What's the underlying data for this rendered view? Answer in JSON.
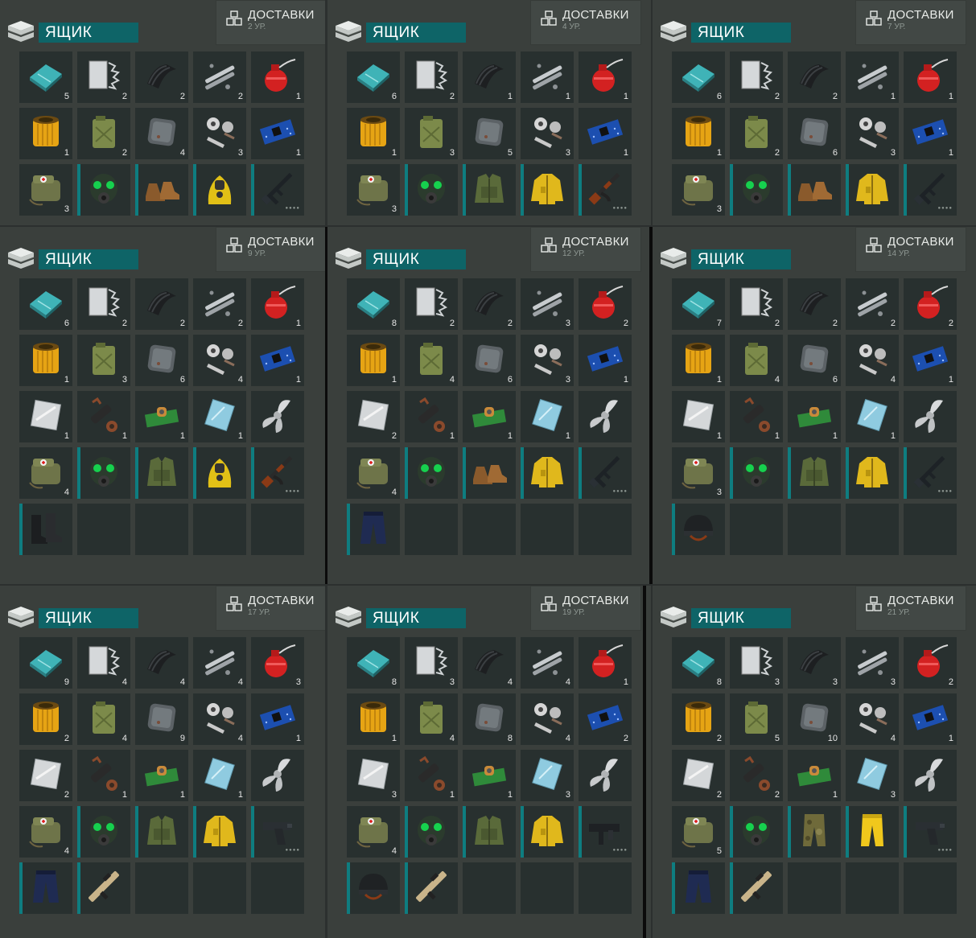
{
  "labels": {
    "box": "ЯЩИК",
    "deliveries": "ДОСТАВКИ"
  },
  "panels": [
    {
      "level": "2 УР.",
      "rows": [
        [
          [
            "glass",
            "5"
          ],
          [
            "scrap",
            "2"
          ],
          [
            "rubber",
            "2"
          ],
          [
            "pipes",
            "2"
          ],
          [
            "oil",
            "1"
          ]
        ],
        [
          [
            "filter",
            "1"
          ],
          [
            "jerrycan",
            "2"
          ],
          [
            "plate",
            "4"
          ],
          [
            "parts",
            "3"
          ],
          [
            "chip",
            "1"
          ]
        ],
        [
          [
            "medbag",
            "3"
          ],
          [
            "gasmask",
            ""
          ],
          [
            "boots",
            ""
          ],
          [
            "hazmat",
            ""
          ],
          [
            "rifle",
            ""
          ]
        ]
      ]
    },
    {
      "level": "4 УР.",
      "rows": [
        [
          [
            "glass",
            "6"
          ],
          [
            "scrap",
            "2"
          ],
          [
            "rubber",
            "1"
          ],
          [
            "pipes",
            "1"
          ],
          [
            "oil",
            "1"
          ]
        ],
        [
          [
            "filter",
            "1"
          ],
          [
            "jerrycan",
            "3"
          ],
          [
            "plate",
            "5"
          ],
          [
            "parts",
            "3"
          ],
          [
            "chip",
            "1"
          ]
        ],
        [
          [
            "medbag",
            "3"
          ],
          [
            "gasmask",
            ""
          ],
          [
            "vest",
            ""
          ],
          [
            "jacket",
            ""
          ],
          [
            "ak",
            ""
          ]
        ]
      ]
    },
    {
      "level": "7 УР.",
      "rows": [
        [
          [
            "glass",
            "6"
          ],
          [
            "scrap",
            "2"
          ],
          [
            "rubber",
            "2"
          ],
          [
            "pipes",
            "1"
          ],
          [
            "oil",
            "1"
          ]
        ],
        [
          [
            "filter",
            "1"
          ],
          [
            "jerrycan",
            "2"
          ],
          [
            "plate",
            "6"
          ],
          [
            "parts",
            "3"
          ],
          [
            "chip",
            "1"
          ]
        ],
        [
          [
            "medbag",
            "3"
          ],
          [
            "gasmask",
            ""
          ],
          [
            "boots",
            ""
          ],
          [
            "jacket",
            ""
          ],
          [
            "rifle",
            ""
          ]
        ]
      ]
    },
    {
      "level": "9 УР.",
      "rows": [
        [
          [
            "glass",
            "6"
          ],
          [
            "scrap",
            "2"
          ],
          [
            "rubber",
            "2"
          ],
          [
            "pipes",
            "2"
          ],
          [
            "oil",
            "1"
          ]
        ],
        [
          [
            "filter",
            "1"
          ],
          [
            "jerrycan",
            "3"
          ],
          [
            "plate",
            "6"
          ],
          [
            "parts",
            "4"
          ],
          [
            "chip",
            "1"
          ]
        ],
        [
          [
            "steel",
            "1"
          ],
          [
            "scope",
            "1"
          ],
          [
            "board",
            "1"
          ],
          [
            "glasspane",
            "1"
          ],
          [
            "propeller",
            ""
          ]
        ],
        [
          [
            "medbag",
            "4"
          ],
          [
            "gasmask",
            ""
          ],
          [
            "vest",
            ""
          ],
          [
            "hazmat",
            ""
          ],
          [
            "ak",
            ""
          ]
        ],
        [
          [
            "tallboots",
            ""
          ],
          [
            "",
            ""
          ],
          [
            "",
            ""
          ],
          [
            "",
            ""
          ],
          [
            "",
            ""
          ]
        ]
      ]
    },
    {
      "level": "12 УР.",
      "rows": [
        [
          [
            "glass",
            "8"
          ],
          [
            "scrap",
            "2"
          ],
          [
            "rubber",
            "2"
          ],
          [
            "pipes",
            "3"
          ],
          [
            "oil",
            "2"
          ]
        ],
        [
          [
            "filter",
            "1"
          ],
          [
            "jerrycan",
            "4"
          ],
          [
            "plate",
            "6"
          ],
          [
            "parts",
            "3"
          ],
          [
            "chip",
            "1"
          ]
        ],
        [
          [
            "steel",
            "2"
          ],
          [
            "scope",
            "1"
          ],
          [
            "board",
            "1"
          ],
          [
            "glasspane",
            "1"
          ],
          [
            "propeller",
            ""
          ]
        ],
        [
          [
            "medbag",
            "4"
          ],
          [
            "gasmask",
            ""
          ],
          [
            "boots",
            ""
          ],
          [
            "jacket",
            ""
          ],
          [
            "rifle",
            ""
          ]
        ],
        [
          [
            "pants",
            ""
          ],
          [
            "",
            ""
          ],
          [
            "",
            ""
          ],
          [
            "",
            ""
          ],
          [
            "",
            ""
          ]
        ]
      ]
    },
    {
      "level": "14 УР.",
      "rows": [
        [
          [
            "glass",
            "7"
          ],
          [
            "scrap",
            "2"
          ],
          [
            "rubber",
            "2"
          ],
          [
            "pipes",
            "2"
          ],
          [
            "oil",
            "2"
          ]
        ],
        [
          [
            "filter",
            "1"
          ],
          [
            "jerrycan",
            "4"
          ],
          [
            "plate",
            "6"
          ],
          [
            "parts",
            "4"
          ],
          [
            "chip",
            "1"
          ]
        ],
        [
          [
            "steel",
            "1"
          ],
          [
            "scope",
            "1"
          ],
          [
            "board",
            "1"
          ],
          [
            "glasspane",
            "1"
          ],
          [
            "propeller",
            ""
          ]
        ],
        [
          [
            "medbag",
            "3"
          ],
          [
            "gasmask",
            ""
          ],
          [
            "vest",
            ""
          ],
          [
            "jacket",
            ""
          ],
          [
            "rifle",
            ""
          ]
        ],
        [
          [
            "helmet",
            ""
          ],
          [
            "",
            ""
          ],
          [
            "",
            ""
          ],
          [
            "",
            ""
          ],
          [
            "",
            ""
          ]
        ]
      ]
    },
    {
      "level": "17 УР.",
      "rows": [
        [
          [
            "glass",
            "9"
          ],
          [
            "scrap",
            "4"
          ],
          [
            "rubber",
            "4"
          ],
          [
            "pipes",
            "4"
          ],
          [
            "oil",
            "3"
          ]
        ],
        [
          [
            "filter",
            "2"
          ],
          [
            "jerrycan",
            "4"
          ],
          [
            "plate",
            "9"
          ],
          [
            "parts",
            "4"
          ],
          [
            "chip",
            "1"
          ]
        ],
        [
          [
            "steel",
            "2"
          ],
          [
            "scope",
            "1"
          ],
          [
            "board",
            "1"
          ],
          [
            "glasspane",
            "1"
          ],
          [
            "propeller",
            ""
          ]
        ],
        [
          [
            "medbag",
            "4"
          ],
          [
            "gasmask",
            ""
          ],
          [
            "vest",
            ""
          ],
          [
            "jacket",
            ""
          ],
          [
            "pistol",
            ""
          ]
        ],
        [
          [
            "pants",
            ""
          ],
          [
            "bullpup",
            ""
          ],
          [
            "",
            ""
          ],
          [
            "",
            ""
          ],
          [
            "",
            ""
          ]
        ]
      ]
    },
    {
      "level": "19 УР.",
      "rows": [
        [
          [
            "glass",
            "8"
          ],
          [
            "scrap",
            "3"
          ],
          [
            "rubber",
            "4"
          ],
          [
            "pipes",
            "4"
          ],
          [
            "oil",
            "1"
          ]
        ],
        [
          [
            "filter",
            "1"
          ],
          [
            "jerrycan",
            "4"
          ],
          [
            "plate",
            "8"
          ],
          [
            "parts",
            "4"
          ],
          [
            "chip",
            "2"
          ]
        ],
        [
          [
            "steel",
            "3"
          ],
          [
            "scope",
            "1"
          ],
          [
            "board",
            "1"
          ],
          [
            "glasspane",
            "3"
          ],
          [
            "propeller",
            ""
          ]
        ],
        [
          [
            "medbag",
            "4"
          ],
          [
            "gasmask",
            ""
          ],
          [
            "vest",
            ""
          ],
          [
            "jacket",
            ""
          ],
          [
            "smg",
            ""
          ]
        ],
        [
          [
            "helmet",
            ""
          ],
          [
            "bullpup",
            ""
          ],
          [
            "",
            ""
          ],
          [
            "",
            ""
          ],
          [
            "",
            ""
          ]
        ]
      ]
    },
    {
      "level": "21 УР.",
      "rows": [
        [
          [
            "glass",
            "8"
          ],
          [
            "scrap",
            "3"
          ],
          [
            "rubber",
            "3"
          ],
          [
            "pipes",
            "3"
          ],
          [
            "oil",
            "2"
          ]
        ],
        [
          [
            "filter",
            "2"
          ],
          [
            "jerrycan",
            "5"
          ],
          [
            "plate",
            "10"
          ],
          [
            "parts",
            "4"
          ],
          [
            "chip",
            "1"
          ]
        ],
        [
          [
            "steel",
            "2"
          ],
          [
            "scope",
            "2"
          ],
          [
            "board",
            "1"
          ],
          [
            "glasspane",
            "3"
          ],
          [
            "propeller",
            ""
          ]
        ],
        [
          [
            "medbag",
            "5"
          ],
          [
            "gasmask",
            ""
          ],
          [
            "camo",
            ""
          ],
          [
            "yellowpants",
            ""
          ],
          [
            "pistol",
            ""
          ]
        ],
        [
          [
            "pants",
            ""
          ],
          [
            "bullpup",
            ""
          ],
          [
            "",
            ""
          ],
          [
            "",
            ""
          ],
          [
            "",
            ""
          ]
        ]
      ]
    }
  ]
}
